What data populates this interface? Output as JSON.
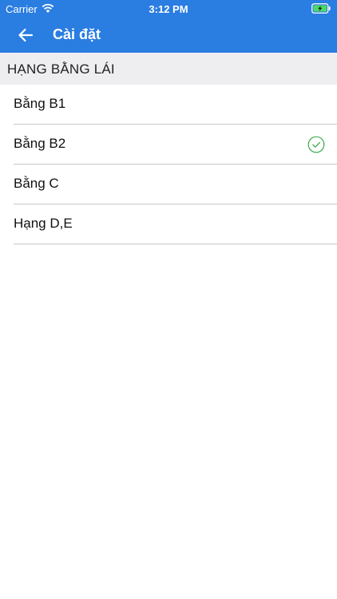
{
  "status_bar": {
    "carrier": "Carrier",
    "time": "3:12 PM"
  },
  "nav": {
    "back_icon": "arrow-left-icon",
    "title": "Cài đặt"
  },
  "section": {
    "header": "HẠNG BẰNG LÁI"
  },
  "items": [
    {
      "label": "Bằng B1",
      "selected": false
    },
    {
      "label": "Bằng B2",
      "selected": true
    },
    {
      "label": "Bằng C",
      "selected": false
    },
    {
      "label": "Hạng D,E",
      "selected": false
    }
  ],
  "colors": {
    "header_bg": "#2a7de1",
    "section_bg": "#eeeef0",
    "check": "#3aa84a",
    "battery": "#4cd964"
  }
}
